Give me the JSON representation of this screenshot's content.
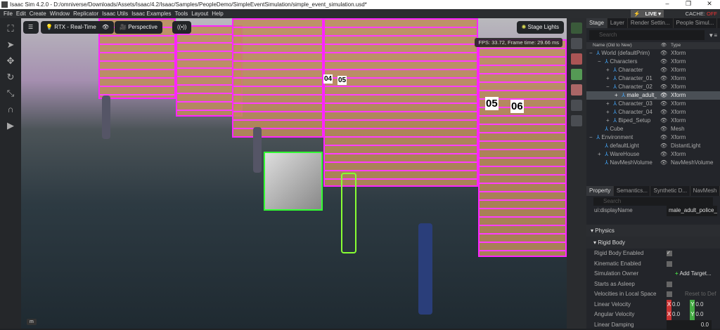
{
  "window": {
    "title": "Isaac Sim 4.2.0 - D:/omniverse/Downloads/Assets/Isaac/4.2/Isaac/Samples/PeopleDemo/SimpleEventSimulation/simple_event_simulation.usd*",
    "minimize": "–",
    "restore": "❐",
    "close": "✕"
  },
  "menu": [
    "File",
    "Edit",
    "Create",
    "Window",
    "Replicator",
    "Isaac Utils",
    "Isaac Examples",
    "Tools",
    "Layout",
    "Help"
  ],
  "status": {
    "live": "LIVE",
    "cache_label": "CACHE:",
    "cache_value": "OFF"
  },
  "viewport": {
    "renderer": "RTX - Real-Time",
    "camera": "Perspective",
    "lights": "Stage Lights",
    "fps": "FPS: 33.72, Frame time: 29.66 ms",
    "key_hint": "m",
    "signs": [
      "04",
      "05",
      "05",
      "06"
    ]
  },
  "stage": {
    "tabs": [
      "Stage",
      "Layer",
      "Render Settin...",
      "People Simul..."
    ],
    "search_placeholder": "Search",
    "col_name": "Name (Old to New)",
    "col_type": "Type",
    "rows": [
      {
        "name": "World (defaultPrim)",
        "type": "Xform",
        "indent": 0,
        "exp": "−"
      },
      {
        "name": "Characters",
        "type": "Xform",
        "indent": 1,
        "exp": "−"
      },
      {
        "name": "Character",
        "type": "Xform",
        "indent": 2,
        "exp": "+"
      },
      {
        "name": "Character_01",
        "type": "Xform",
        "indent": 2,
        "exp": "+"
      },
      {
        "name": "Character_02",
        "type": "Xform",
        "indent": 2,
        "exp": "−"
      },
      {
        "name": "male_adult_",
        "type": "Xform",
        "indent": 3,
        "exp": "+",
        "selected": true
      },
      {
        "name": "Character_03",
        "type": "Xform",
        "indent": 2,
        "exp": "+"
      },
      {
        "name": "Character_04",
        "type": "Xform",
        "indent": 2,
        "exp": "+"
      },
      {
        "name": "Biped_Setup",
        "type": "Xform",
        "indent": 2,
        "exp": "+"
      },
      {
        "name": "Cube",
        "type": "Mesh",
        "indent": 1,
        "exp": ""
      },
      {
        "name": "Environment",
        "type": "Xform",
        "indent": 0,
        "exp": "−"
      },
      {
        "name": "defaultLight",
        "type": "DistantLight",
        "indent": 1,
        "exp": ""
      },
      {
        "name": "WareHouse",
        "type": "Xform",
        "indent": 1,
        "exp": "+"
      },
      {
        "name": "NavMeshVolume",
        "type": "NavMeshVolume",
        "indent": 1,
        "exp": ""
      }
    ]
  },
  "property": {
    "tabs": [
      "Property",
      "Semantics...",
      "Synthetic D...",
      "NavMesh"
    ],
    "search_placeholder": "Search",
    "display_name_label": "ui:displayName",
    "display_name_value": "male_adult_police_",
    "physics": "Physics",
    "rigid_body": "Rigid Body",
    "rigid_body_enabled": "Rigid Body Enabled",
    "kinematic_enabled": "Kinematic Enabled",
    "simulation_owner": "Simulation Owner",
    "add_target": "Add Target...",
    "starts_asleep": "Starts as Asleep",
    "velocities_local": "Velocities in Local Space",
    "reset": "Reset to Def",
    "linear_velocity": "Linear Velocity",
    "angular_velocity": "Angular Velocity",
    "linear_damping": "Linear Damping",
    "damping_value": "0.0",
    "x": "X",
    "y": "Y",
    "vx": "0.0",
    "vy": "0.0"
  }
}
